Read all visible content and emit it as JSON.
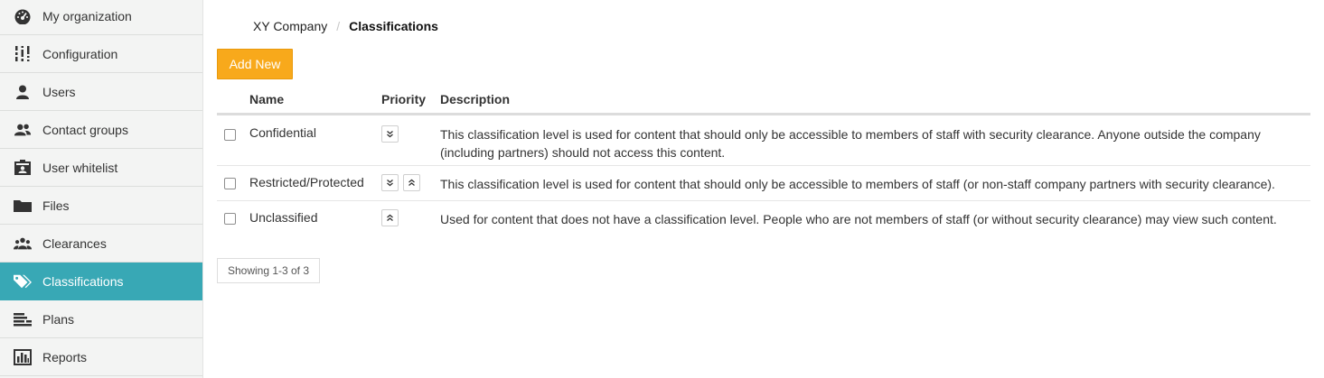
{
  "sidebar": {
    "items": [
      {
        "label": "My organization",
        "icon": "dashboard-icon",
        "active": false
      },
      {
        "label": "Configuration",
        "icon": "sliders-icon",
        "active": false
      },
      {
        "label": "Users",
        "icon": "user-icon",
        "active": false
      },
      {
        "label": "Contact groups",
        "icon": "users-group-icon",
        "active": false
      },
      {
        "label": "User whitelist",
        "icon": "id-card-icon",
        "active": false
      },
      {
        "label": "Files",
        "icon": "folder-icon",
        "active": false
      },
      {
        "label": "Clearances",
        "icon": "users-group-icon",
        "active": false
      },
      {
        "label": "Classifications",
        "icon": "tags-icon",
        "active": true
      },
      {
        "label": "Plans",
        "icon": "plans-icon",
        "active": false
      },
      {
        "label": "Reports",
        "icon": "bar-chart-icon",
        "active": false
      }
    ]
  },
  "breadcrumb": {
    "company": "XY Company",
    "separator": "/",
    "current": "Classifications"
  },
  "toolbar": {
    "add_label": "Add New"
  },
  "table": {
    "columns": {
      "name": "Name",
      "priority": "Priority",
      "description": "Description"
    },
    "rows": [
      {
        "name": "Confidential",
        "priority_controls": [
          "down"
        ],
        "description": "This classification level is used for content that should only be accessible to members of staff with security clearance. Anyone outside the company (including partners) should not access this content."
      },
      {
        "name": "Restricted/Protected",
        "priority_controls": [
          "down",
          "up"
        ],
        "description": "This classification level is used for content that should only be accessible to members of staff (or non-staff company partners with security clearance)."
      },
      {
        "name": "Unclassified",
        "priority_controls": [
          "up"
        ],
        "description": "Used for content that does not have a classification level. People who are not members of staff (or without security clearance) may view such content."
      }
    ]
  },
  "pagination": {
    "summary": "Showing 1-3 of 3"
  },
  "colors": {
    "accent": "#38a8b5",
    "add_button": "#f8a91b"
  }
}
